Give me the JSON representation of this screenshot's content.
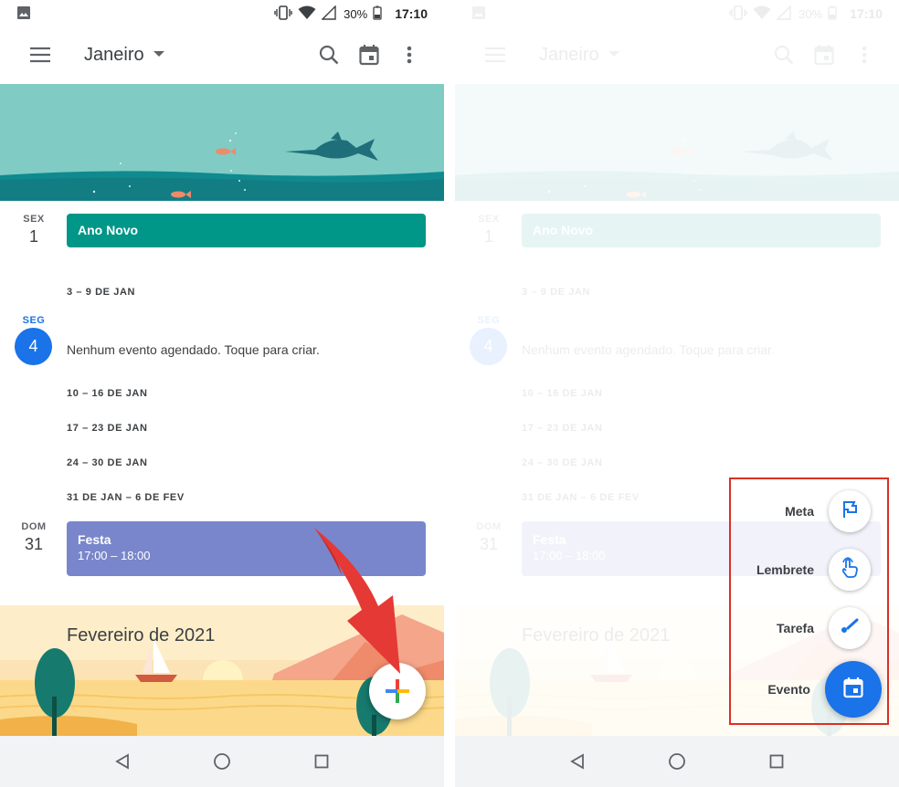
{
  "status_bar": {
    "battery_percent": "30%",
    "time": "17:10"
  },
  "app_bar": {
    "month": "Janeiro"
  },
  "schedule": {
    "day1": {
      "dow": "SEX",
      "num": "1",
      "event": "Ano Novo",
      "color": "#009688"
    },
    "week1": "3 – 9 DE JAN",
    "today": {
      "dow": "SEG",
      "num": "4",
      "empty_text": "Nenhum evento agendado. Toque para criar."
    },
    "weeks": [
      "10 – 16 DE JAN",
      "17 – 23 DE JAN",
      "24 – 30 DE JAN",
      "31 DE JAN – 6 DE FEV"
    ],
    "day31": {
      "dow": "DOM",
      "num": "31",
      "event": "Festa",
      "time": "17:00 – 18:00",
      "color": "#7986cb"
    },
    "month_header": "Fevereiro de 2021"
  },
  "speed_dial": {
    "items": [
      {
        "label": "Meta",
        "icon": "flag-icon"
      },
      {
        "label": "Lembrete",
        "icon": "reminder-hand-icon"
      },
      {
        "label": "Tarefa",
        "icon": "task-check-icon"
      },
      {
        "label": "Evento",
        "icon": "calendar-event-icon"
      }
    ]
  },
  "colors": {
    "accent": "#1a73e8",
    "highlight_box": "#d93025",
    "arrow": "#e53935"
  }
}
